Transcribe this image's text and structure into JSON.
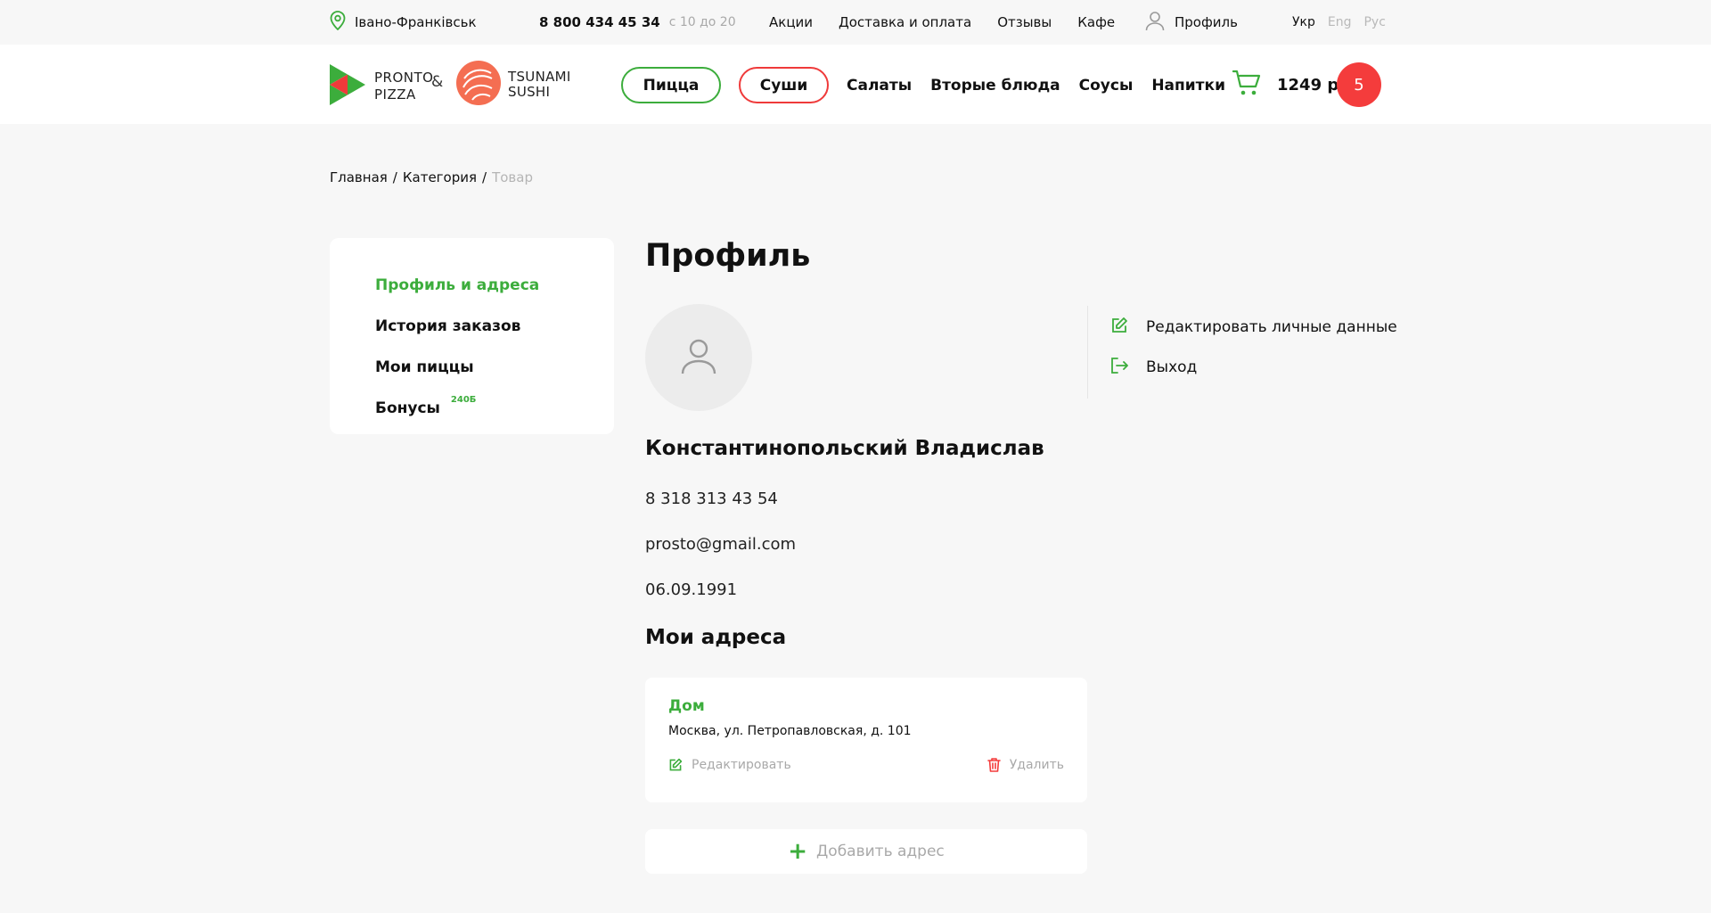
{
  "topbar": {
    "city": "Івано-Франківськ",
    "phone": "8 800 434 45 34",
    "hours": "с 10 до 20",
    "nav": [
      "Акции",
      "Доставка и оплата",
      "Отзывы",
      "Кафе"
    ],
    "profile": "Профиль",
    "langs": [
      {
        "label": "Укр",
        "active": true
      },
      {
        "label": "Eng",
        "active": false
      },
      {
        "label": "Рус",
        "active": false
      }
    ]
  },
  "header": {
    "logo_pronto_line1": "PRONTO",
    "logo_pronto_line2": "PIZZA",
    "amp": "&",
    "logo_tsunami_line1": "TSUNAMI",
    "logo_tsunami_line2": "SUSHI",
    "pill_pizza": "Пицца",
    "pill_sushi": "Суши",
    "nav": [
      "Салаты",
      "Вторые блюда",
      "Соусы",
      "Напитки"
    ],
    "cart_total": "1249 р",
    "cart_count": "5"
  },
  "breadcrumb": {
    "home": "Главная",
    "sep": "/",
    "category": "Категория",
    "current": "Товар"
  },
  "sidemenu": {
    "items": [
      "Профиль и адреса",
      "История заказов",
      "Мои пиццы",
      "Бонусы"
    ],
    "bonus_badge": "240Б"
  },
  "profile": {
    "title": "Профиль",
    "name": "Константинопольский Владислав",
    "phone": "8 318 313 43 54",
    "email": "prosto@gmail.com",
    "birthdate": "06.09.1991",
    "edit_label": "Редактировать личные данные",
    "logout_label": "Выход"
  },
  "addresses": {
    "title": "Мои адреса",
    "items": [
      {
        "name": "Дом",
        "address": "Москва, ул. Петропавловская, д. 101",
        "edit": "Редактировать",
        "delete": "Удалить"
      }
    ],
    "add_label": "Добавить адрес"
  },
  "colors": {
    "green": "#3cad3c",
    "red": "#f43c3c",
    "background": "#f7f7f7"
  }
}
